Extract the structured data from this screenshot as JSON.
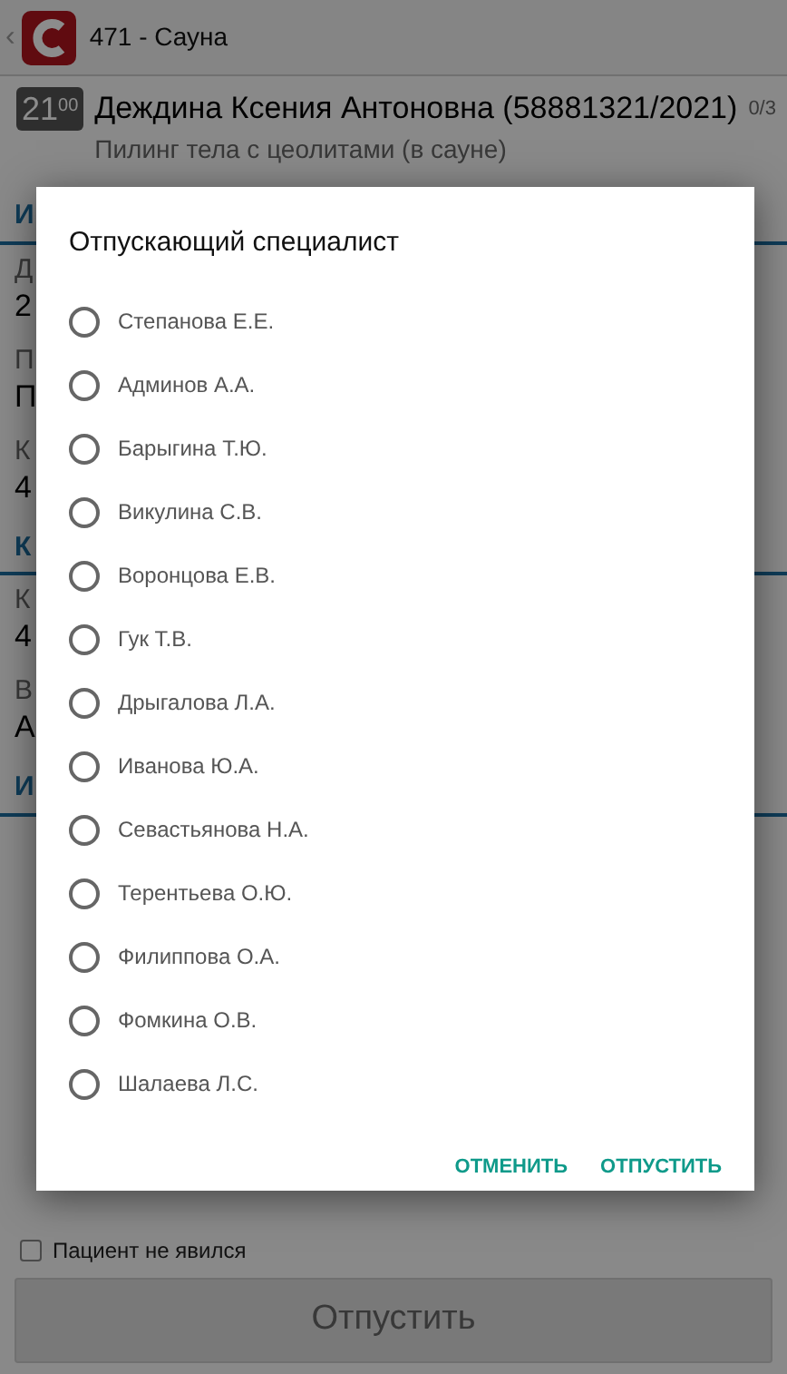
{
  "app_bar": {
    "back": "‹",
    "title": "471 - Сауна"
  },
  "appointment": {
    "hour": "21",
    "minutes": "00",
    "patient": "Деждина Ксения Антоновна (58881321/2021)",
    "procedure": "Пилинг тела с цеолитами (в сауне)",
    "counter": "0/3"
  },
  "sections": [
    {
      "title": "И",
      "fields": [
        {
          "label": "Д",
          "value": "2"
        },
        {
          "label": "П",
          "value": "П"
        },
        {
          "label": "К",
          "value": "4"
        }
      ]
    },
    {
      "title": "К",
      "fields": [
        {
          "label": "К",
          "value": "4"
        },
        {
          "label": "В",
          "value": "А"
        }
      ]
    },
    {
      "title": "И"
    }
  ],
  "dialog": {
    "title": "Отпускающий специалист",
    "options": [
      {
        "label": "Степанова Е.Е.",
        "selected": false
      },
      {
        "label": "Админов А.А.",
        "selected": false
      },
      {
        "label": "Барыгина Т.Ю.",
        "selected": false
      },
      {
        "label": "Викулина С.В.",
        "selected": false
      },
      {
        "label": "Воронцова Е.В.",
        "selected": false
      },
      {
        "label": "Гук Т.В.",
        "selected": false
      },
      {
        "label": "Дрыгалова Л.А.",
        "selected": false
      },
      {
        "label": "Иванова Ю.А.",
        "selected": false
      },
      {
        "label": "Севастьянова Н.А.",
        "selected": false
      },
      {
        "label": "Терентьева О.Ю.",
        "selected": false
      },
      {
        "label": "Филиппова О.А.",
        "selected": false
      },
      {
        "label": "Фомкина О.В.",
        "selected": false
      },
      {
        "label": "Шалаева Л.С.",
        "selected": false
      }
    ],
    "buttons": [
      "ОТМЕНИТЬ",
      "ОТПУСТИТЬ"
    ]
  },
  "no_show": {
    "label": "Пациент не явился",
    "checked": false
  },
  "release_button": {
    "label": "Отпустить",
    "disabled": true
  }
}
